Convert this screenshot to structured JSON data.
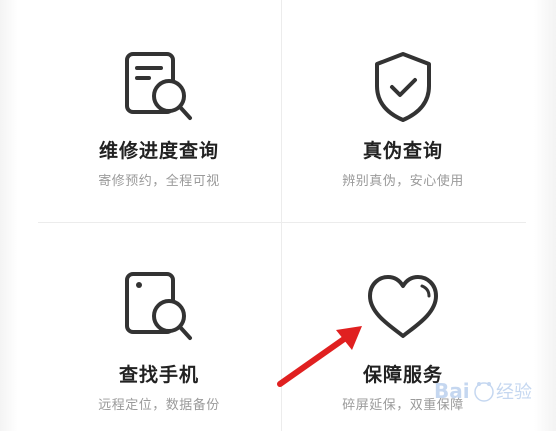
{
  "tiles": [
    {
      "title": "维修进度查询",
      "subtitle": "寄修预约，全程可视",
      "icon": "document-search-icon"
    },
    {
      "title": "真伪查询",
      "subtitle": "辨别真伪，安心使用",
      "icon": "shield-check-icon"
    },
    {
      "title": "查找手机",
      "subtitle": "远程定位，数据备份",
      "icon": "phone-search-icon"
    },
    {
      "title": "保障服务",
      "subtitle": "碎屏延保，双重保障",
      "icon": "heart-icon"
    }
  ],
  "watermark": {
    "brand": "Baidu",
    "subtext": "经验"
  },
  "colors": {
    "icon_stroke": "#333333",
    "title": "#222222",
    "subtitle": "#9a9a9a",
    "arrow": "#e02020"
  }
}
